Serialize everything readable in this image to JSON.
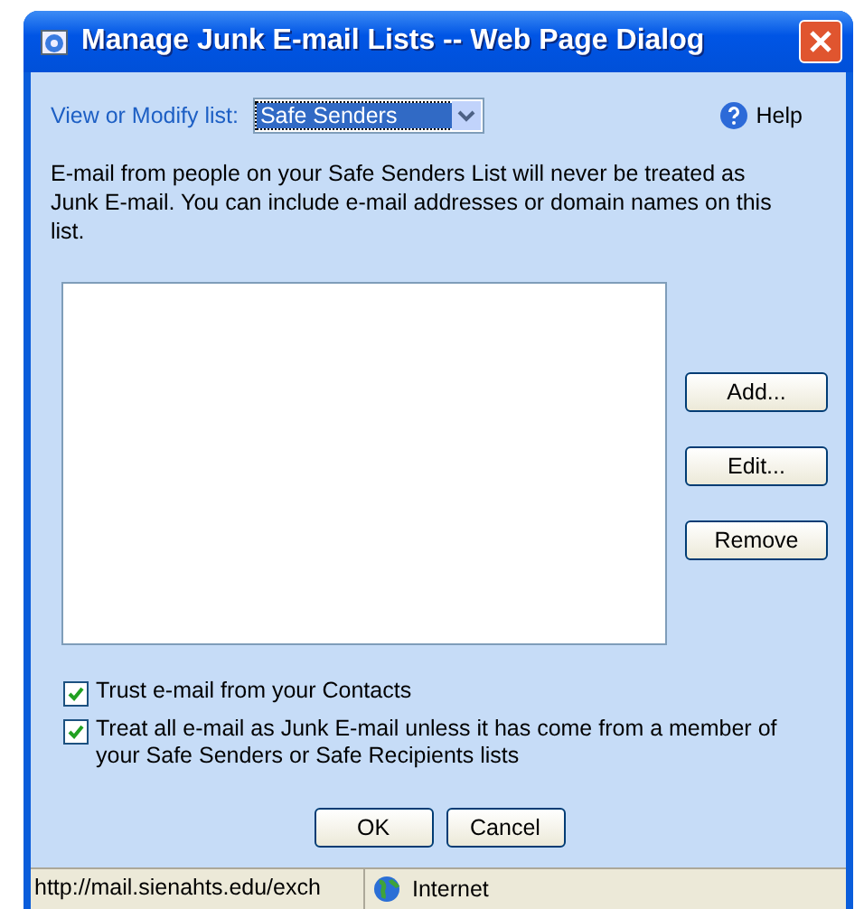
{
  "window": {
    "title": "Manage Junk E-mail Lists -- Web Page Dialog"
  },
  "list_selector": {
    "label": "View or Modify list:",
    "value": "Safe Senders"
  },
  "help": "Help",
  "description": "E-mail from people on your Safe Senders List will never be treated as Junk E-mail.  You can include e-mail addresses or domain names on this list.",
  "side_buttons": [
    "Add...",
    "Edit...",
    "Remove"
  ],
  "options": [
    {
      "label": "Trust e-mail from your Contacts",
      "checked": true
    },
    {
      "label": "Treat all e-mail as Junk E-mail unless it has come from a member of your Safe Senders or Safe Recipients lists",
      "checked": true
    }
  ],
  "buttons": [
    "OK",
    "Cancel"
  ],
  "status_bar": {
    "url": "http://mail.sienahts.edu/exch",
    "zone": "Internet"
  }
}
